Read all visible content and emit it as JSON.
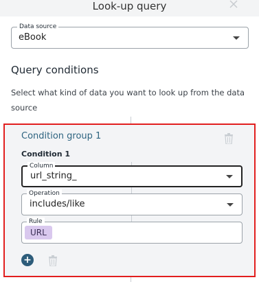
{
  "dialog": {
    "title": "Look-up query"
  },
  "data_source": {
    "label": "Data source",
    "value": "eBook"
  },
  "query_conditions": {
    "title": "Query conditions",
    "description": "Select what kind of data you want to look up from the data source"
  },
  "condition_group": {
    "title": "Condition group 1",
    "condition": {
      "title": "Condition 1",
      "column": {
        "label": "Column",
        "value": "url_string_"
      },
      "operation": {
        "label": "Operation",
        "value": "includes/like"
      },
      "rule": {
        "label": "Rule",
        "chip": "URL"
      }
    },
    "add_label": "+"
  },
  "colors": {
    "accent": "#2d5c7a",
    "highlight_border": "#e11d1d",
    "chip_bg": "#d9c8ee"
  }
}
